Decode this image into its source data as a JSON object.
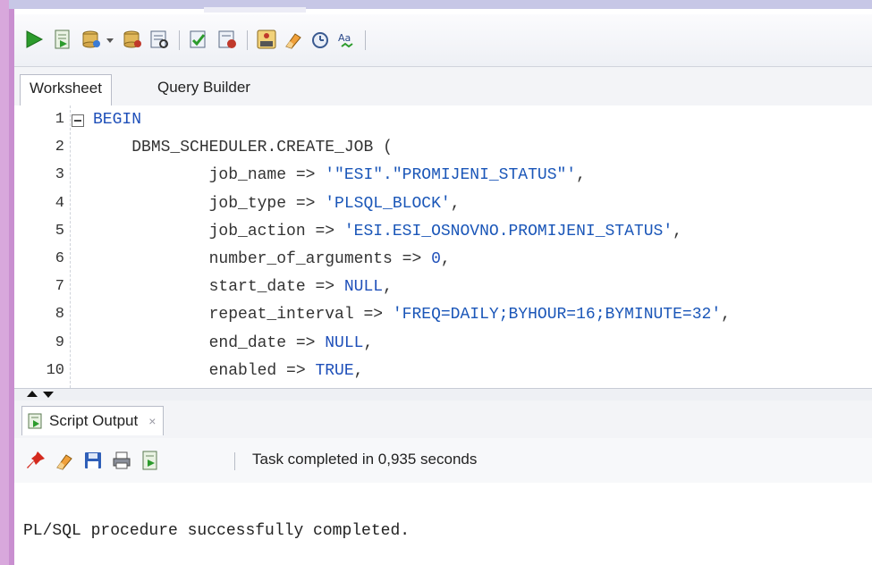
{
  "toolbar": {
    "icons": [
      "run-statement-icon",
      "run-script-icon",
      "commit-icon",
      "commit-dropdown-icon",
      "rollback-icon",
      "autotrace-icon",
      "explain-plan-icon",
      "sql-tuning-icon",
      "sql-history-icon",
      "clear-icon",
      "unshared-worksheet-icon",
      "format-icon"
    ]
  },
  "tabs": [
    "Worksheet",
    "Query Builder"
  ],
  "editor": {
    "line_numbers": [
      "1",
      "2",
      "3",
      "4",
      "5",
      "6",
      "7",
      "8",
      "9",
      "10"
    ],
    "lines": [
      {
        "indent": "",
        "parts": [
          {
            "t": "BEGIN",
            "c": "kw"
          }
        ]
      },
      {
        "indent": "    ",
        "parts": [
          {
            "t": "DBMS_SCHEDULER.CREATE_JOB (",
            "c": ""
          }
        ]
      },
      {
        "indent": "            ",
        "parts": [
          {
            "t": "job_name => ",
            "c": ""
          },
          {
            "t": "'\"ESI\".\"PROMIJENI_STATUS\"'",
            "c": "str"
          },
          {
            "t": ",",
            "c": ""
          }
        ]
      },
      {
        "indent": "            ",
        "parts": [
          {
            "t": "job_type => ",
            "c": ""
          },
          {
            "t": "'PLSQL_BLOCK'",
            "c": "str"
          },
          {
            "t": ",",
            "c": ""
          }
        ]
      },
      {
        "indent": "            ",
        "parts": [
          {
            "t": "job_action => ",
            "c": ""
          },
          {
            "t": "'ESI.ESI_OSNOVNO.PROMIJENI_STATUS'",
            "c": "str"
          },
          {
            "t": ",",
            "c": ""
          }
        ]
      },
      {
        "indent": "            ",
        "parts": [
          {
            "t": "number_of_arguments => ",
            "c": ""
          },
          {
            "t": "0",
            "c": "num"
          },
          {
            "t": ",",
            "c": ""
          }
        ]
      },
      {
        "indent": "            ",
        "parts": [
          {
            "t": "start_date => ",
            "c": ""
          },
          {
            "t": "NULL",
            "c": "kw"
          },
          {
            "t": ",",
            "c": ""
          }
        ]
      },
      {
        "indent": "            ",
        "parts": [
          {
            "t": "repeat_interval => ",
            "c": ""
          },
          {
            "t": "'FREQ=DAILY;BYHOUR=16;BYMINUTE=32'",
            "c": "str"
          },
          {
            "t": ",",
            "c": ""
          }
        ]
      },
      {
        "indent": "            ",
        "parts": [
          {
            "t": "end_date => ",
            "c": ""
          },
          {
            "t": "NULL",
            "c": "kw"
          },
          {
            "t": ",",
            "c": ""
          }
        ]
      },
      {
        "indent": "            ",
        "parts": [
          {
            "t": "enabled => ",
            "c": ""
          },
          {
            "t": "TRUE",
            "c": "kw"
          },
          {
            "t": ",",
            "c": ""
          }
        ]
      }
    ]
  },
  "output_panel": {
    "tab_label": "Script Output",
    "close_label": "×",
    "status": "Task completed in 0,935 seconds",
    "text": "PL/SQL procedure successfully completed."
  }
}
